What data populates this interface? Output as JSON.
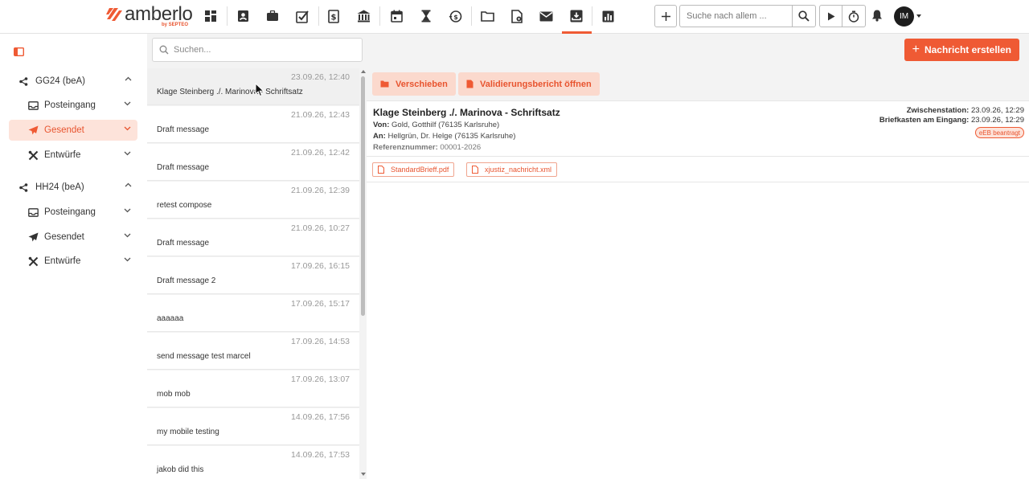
{
  "brand": {
    "name": "amberlo",
    "sub": "by SEPTEO"
  },
  "topbar": {
    "search_placeholder": "Suche nach allem ...",
    "avatar_initials": "IM"
  },
  "sidebar": {
    "accounts": [
      {
        "label": "GG24 (beA)",
        "folders": [
          {
            "label": "Posteingang"
          },
          {
            "label": "Gesendet"
          },
          {
            "label": "Entwürfe"
          }
        ]
      },
      {
        "label": "HH24 (beA)",
        "folders": [
          {
            "label": "Posteingang"
          },
          {
            "label": "Gesendet"
          },
          {
            "label": "Entwürfe"
          }
        ]
      }
    ]
  },
  "list": {
    "search_placeholder": "Suchen...",
    "messages": [
      {
        "date": "23.09.26, 12:40",
        "subject": "Klage Steinberg ./. Marinova - Schriftsatz"
      },
      {
        "date": "21.09.26, 12:43",
        "subject": "Draft message"
      },
      {
        "date": "21.09.26, 12:42",
        "subject": "Draft message"
      },
      {
        "date": "21.09.26, 12:39",
        "subject": "retest compose"
      },
      {
        "date": "21.09.26, 10:27",
        "subject": "Draft message"
      },
      {
        "date": "17.09.26, 16:15",
        "subject": "Draft message 2"
      },
      {
        "date": "17.09.26, 15:17",
        "subject": "aaaaaa"
      },
      {
        "date": "17.09.26, 14:53",
        "subject": "send message test marcel"
      },
      {
        "date": "17.09.26, 13:07",
        "subject": "mob mob"
      },
      {
        "date": "14.09.26, 17:56",
        "subject": "my mobile testing"
      },
      {
        "date": "14.09.26, 17:53",
        "subject": "jakob did this"
      }
    ]
  },
  "content": {
    "create_label": "Nachricht erstellen",
    "actions": {
      "move": "Verschieben",
      "report": "Validierungsbericht öffnen"
    },
    "detail": {
      "title": "Klage Steinberg ./. Marinova - Schriftsatz",
      "from_label": "Von:",
      "from": "Gold, Gotthilf (76135 Karlsruhe)",
      "to_label": "An:",
      "to": "Hellgrün, Dr. Helge (76135 Karlsruhe)",
      "ref_label": "Referenznummer:",
      "ref": "00001-2026",
      "station_label": "Zwischenstation:",
      "station": "23.09.26, 12:29",
      "mailbox_label": "Briefkasten am Eingang:",
      "mailbox": "23.09.26, 12:29",
      "badge": "eEB beantragt"
    },
    "attachments": [
      "StandardBrieff.pdf",
      "xjustiz_nachricht.xml"
    ]
  },
  "colors": {
    "accent": "#ef5a34",
    "accent_light": "#fde3da"
  }
}
